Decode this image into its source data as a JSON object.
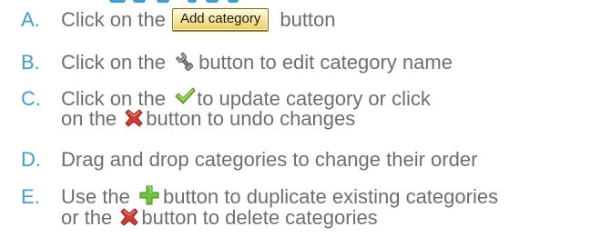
{
  "steps": [
    {
      "letter": "A.",
      "before": "Click on the",
      "button_label": "Add category",
      "after": "button"
    },
    {
      "letter": "B.",
      "before": "Click on the",
      "icon": "wrench-icon",
      "after": "button to edit category name"
    },
    {
      "letter": "C.",
      "before": "Click on the",
      "icon": "checkmark-icon",
      "after": "to update category or click",
      "line2_before": "on the",
      "line2_icon": "delete-x-icon",
      "line2_after": "button to undo changes"
    },
    {
      "letter": "D.",
      "text": "Drag and drop categories to change their order"
    },
    {
      "letter": "E.",
      "before": "Use the",
      "icon": "add-plus-icon",
      "after": "button to duplicate existing categories",
      "line2_before": "or the",
      "line2_icon": "delete-x-icon",
      "line2_after": "button to delete categories"
    }
  ],
  "colors": {
    "letter": "#3c9fd6",
    "text": "#6e6e6e",
    "button_bg": "#f8e9a6",
    "button_border": "#8b6a1c",
    "checkmark": "#7dc02a",
    "plus": "#6cc43a",
    "delete": "#d63b2f"
  }
}
